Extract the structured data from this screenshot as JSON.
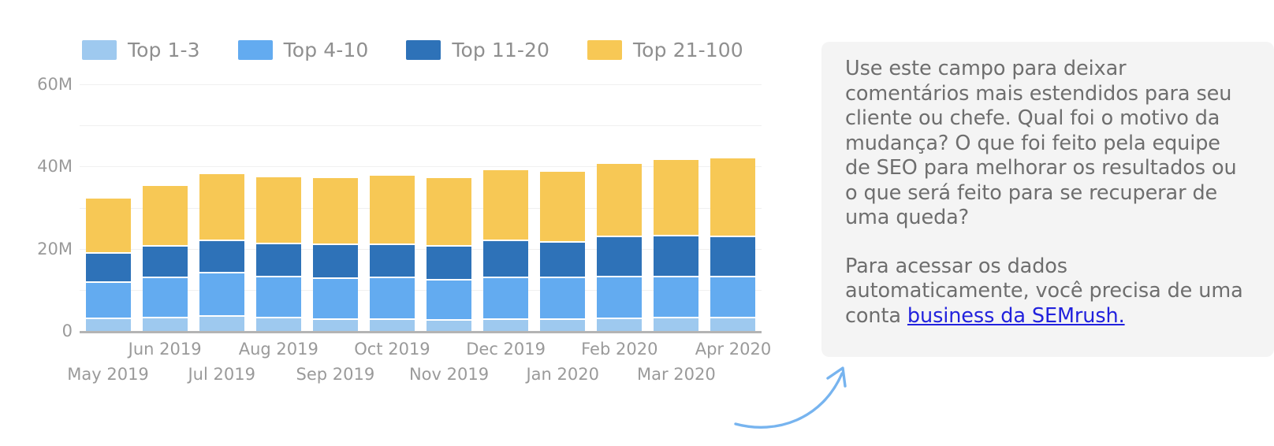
{
  "chart_data": {
    "type": "bar",
    "subtype": "stacked",
    "title": "",
    "xlabel": "",
    "ylabel": "",
    "grid": true,
    "legend_position": "top-left",
    "ylim": [
      0,
      60000000
    ],
    "ytick_labels": [
      "0",
      "20M",
      "40M",
      "60M"
    ],
    "ytick_values": [
      0,
      20000000,
      40000000,
      60000000
    ],
    "gridline_values": [
      0,
      10000000,
      20000000,
      30000000,
      40000000,
      50000000,
      60000000
    ],
    "categories": [
      "May 2019",
      "Jun 2019",
      "Jul 2019",
      "Aug 2019",
      "Sep 2019",
      "Oct 2019",
      "Nov 2019",
      "Dec 2019",
      "Jan 2020",
      "Feb 2020",
      "Mar 2020",
      "Apr 2020"
    ],
    "series": [
      {
        "name": "Top 1-3",
        "color": "#9ec9ef",
        "values": [
          2.9,
          3.0,
          3.5,
          3.1,
          2.6,
          2.6,
          2.5,
          2.6,
          2.7,
          2.9,
          3.1,
          3.1
        ]
      },
      {
        "name": "Top 4-10",
        "color": "#63abf0",
        "values": [
          8.5,
          9.5,
          10.2,
          9.6,
          9.7,
          9.8,
          9.4,
          9.8,
          9.7,
          9.8,
          9.6,
          9.6
        ]
      },
      {
        "name": "Top 11-20",
        "color": "#2e72b8",
        "values": [
          6.6,
          7.2,
          7.4,
          7.6,
          7.9,
          7.8,
          7.8,
          8.6,
          8.4,
          9.4,
          9.6,
          9.4
        ]
      },
      {
        "name": "Top 21-100",
        "color": "#f7c855",
        "values": [
          13.1,
          14.5,
          15.9,
          15.9,
          15.9,
          16.4,
          16.4,
          16.9,
          16.7,
          17.4,
          18.1,
          18.8
        ]
      }
    ],
    "value_unit": "M"
  },
  "legend": {
    "items": [
      {
        "label": "Top 1-3",
        "color": "#9ec9ef"
      },
      {
        "label": "Top 4-10",
        "color": "#63abf0"
      },
      {
        "label": "Top 11-20",
        "color": "#2e72b8"
      },
      {
        "label": "Top 21-100",
        "color": "#f7c855"
      }
    ]
  },
  "comment_panel": {
    "paragraph_1": "Use este campo para deixar comentários mais estendidos para seu cliente ou chefe. Qual foi o motivo da mudança? O que foi feito pela equipe de SEO para melhorar os resultados ou o que será feito para se recuperar de uma queda?",
    "paragraph_2_before_link": "Para acessar os dados automaticamente, você precisa de uma conta ",
    "link_text": "business da SEMrush.",
    "link_color": "#2222dd",
    "background_color": "#f4f4f4",
    "text_color": "#6e6e6e"
  },
  "callout": {
    "arrow_color": "#77b4ef",
    "arrow_name": "curved-arrow-pointing-to-comment-panel"
  }
}
